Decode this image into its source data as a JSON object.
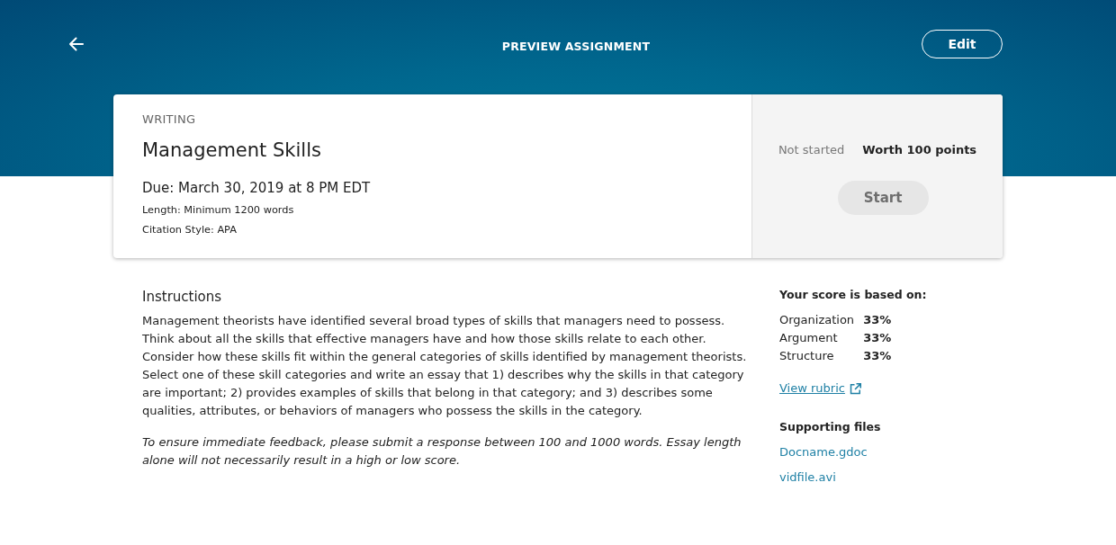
{
  "header": {
    "title": "PREVIEW ASSIGNMENT",
    "edit_button": "Edit"
  },
  "assignment": {
    "category": "WRITING",
    "title": "Management Skills",
    "due": "Due: March 30, 2019 at 8 PM EDT",
    "details": [
      "Length: Minimum 1200 words",
      "Citation Style: APA"
    ],
    "status": "Not started",
    "points": "Worth 100 points",
    "start_button": {
      "label": "Start",
      "disabled": true
    }
  },
  "instructions": {
    "heading": "Instructions",
    "body": "Management theorists have identified several broad types of skills that managers need to possess. Think about all the skills that effective managers have and how those skills relate to each other. Consider how these skills fit within the general categories of skills identified by management theorists. Select one of these skill categories and write an essay that 1) describes why the skills in that category are important; 2) provides examples of skills that belong in that category; and 3) describes some qualities, attributes, or behaviors of managers who possess the skills in the category.",
    "note": "To ensure immediate feedback, please submit a response between 100 and 1000 words. Essay length alone will not necessarily result in a high or low score."
  },
  "score": {
    "heading": "Your score is based on:",
    "criteria": [
      {
        "name": "Organization",
        "weight": "33%"
      },
      {
        "name": "Argument",
        "weight": "33%"
      },
      {
        "name": "Structure",
        "weight": "33%"
      }
    ],
    "rubric_link": "View rubric"
  },
  "supporting_files": {
    "heading": "Supporting files",
    "files": [
      "Docname.gdoc",
      "vidfile.avi"
    ]
  }
}
